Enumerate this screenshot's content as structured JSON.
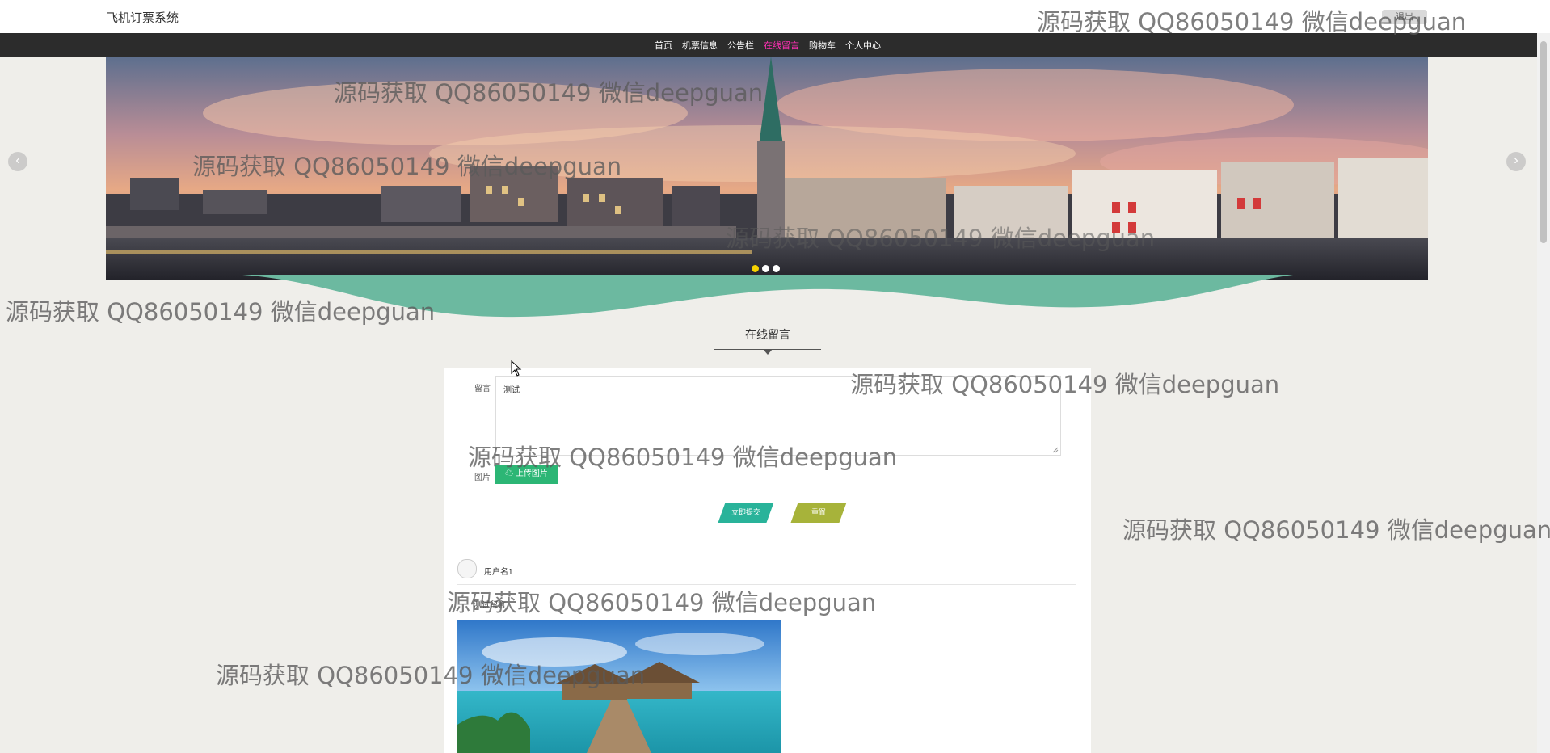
{
  "header": {
    "site_title": "飞机订票系统",
    "top_button": "退出"
  },
  "nav": {
    "items": [
      {
        "label": "首页",
        "active": false
      },
      {
        "label": "机票信息",
        "active": false
      },
      {
        "label": "公告栏",
        "active": false
      },
      {
        "label": "在线留言",
        "active": true
      },
      {
        "label": "购物车",
        "active": false
      },
      {
        "label": "个人中心",
        "active": false
      }
    ],
    "active_color": "#ff2fb4"
  },
  "carousel": {
    "prev_glyph": "‹",
    "next_glyph": "›",
    "dots_count": 3,
    "active_dot": 1
  },
  "section": {
    "title": "在线留言"
  },
  "form": {
    "message_label": "留言",
    "message_value": "测试",
    "image_label": "图片",
    "upload_label": "上传图片",
    "submit_label": "立即提交",
    "reset_label": "重置"
  },
  "comment": {
    "username": "用户名1",
    "content": "测试留言"
  },
  "watermark": {
    "text": "源码获取 QQ86050149 微信deepguan"
  },
  "colors": {
    "upload": "#2cb675",
    "submit": "#29b39a",
    "reset": "#a7b33a",
    "nav_bg": "#2c2c2c",
    "wave": "#6cb9a0"
  }
}
